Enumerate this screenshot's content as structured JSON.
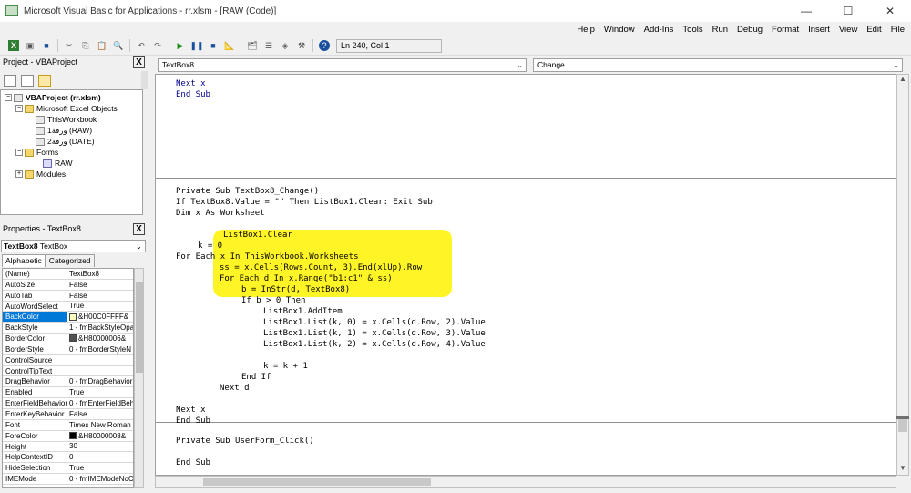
{
  "window": {
    "title": "Microsoft Visual Basic for Applications - rr.xlsm - [RAW (Code)]",
    "controls": [
      "—",
      "☐",
      "✕"
    ]
  },
  "menu": [
    "File",
    "Edit",
    "View",
    "Insert",
    "Format",
    "Debug",
    "Run",
    "Tools",
    "Add-Ins",
    "Window",
    "Help"
  ],
  "toolbar": {
    "position": "Ln 240, Col 1"
  },
  "project": {
    "header": "Project - VBAProject",
    "close": "X",
    "root": "VBAProject (rr.xlsm)",
    "excel_objects_folder": "Microsoft Excel Objects",
    "this_workbook": "ThisWorkbook",
    "sheet1": "ورقة1 (RAW)",
    "sheet2": "ورقة2 (DATE)",
    "forms_folder": "Forms",
    "form_raw": "RAW",
    "modules_folder": "Modules"
  },
  "properties": {
    "header": "Properties - TextBox8",
    "close": "X",
    "object_name": "TextBox8",
    "object_type": "TextBox",
    "tab_alphabetic": "Alphabetic",
    "tab_categorized": "Categorized",
    "rows": [
      {
        "name": "(Name)",
        "value": "TextBox8"
      },
      {
        "name": "AutoSize",
        "value": "False"
      },
      {
        "name": "AutoTab",
        "value": "False"
      },
      {
        "name": "AutoWordSelect",
        "value": "True"
      },
      {
        "name": "BackColor",
        "value": "&H00C0FFFF&"
      },
      {
        "name": "BackStyle",
        "value": "1 - fmBackStyleOpa"
      },
      {
        "name": "BorderColor",
        "value": "&H80000006&"
      },
      {
        "name": "BorderStyle",
        "value": "0 - fmBorderStyleN"
      },
      {
        "name": "ControlSource",
        "value": ""
      },
      {
        "name": "ControlTipText",
        "value": ""
      },
      {
        "name": "DragBehavior",
        "value": "0 - fmDragBehavior"
      },
      {
        "name": "Enabled",
        "value": "True"
      },
      {
        "name": "EnterFieldBehavior",
        "value": "0 - fmEnterFieldBeh"
      },
      {
        "name": "EnterKeyBehavior",
        "value": "False"
      },
      {
        "name": "Font",
        "value": "Times New Roman"
      },
      {
        "name": "ForeColor",
        "value": "&H80000008&"
      },
      {
        "name": "Height",
        "value": "30"
      },
      {
        "name": "HelpContextID",
        "value": "0"
      },
      {
        "name": "HideSelection",
        "value": "True"
      },
      {
        "name": "IMEMode",
        "value": "0 - fmIMEModeNoC"
      }
    ]
  },
  "code": {
    "object_combo": "TextBox8",
    "procedure_combo": "Change",
    "lines": [
      "Next x",
      "End Sub",
      "Private Sub TextBox8_Change()",
      "If TextBox8.Value = \"\" Then ListBox1.Clear: Exit Sub",
      "Dim x As Worksheet",
      "ListBox1.Clear",
      "k = 0",
      "For Each x In ThisWorkbook.Worksheets",
      "ss = x.Cells(Rows.Count, 3).End(xlUp).Row",
      "For Each d In x.Range(\"b1:c1\" & ss)",
      "b = InStr(d, TextBox8)",
      "If b > 0 Then",
      "ListBox1.AddItem",
      "ListBox1.List(k, 0) = x.Cells(d.Row, 2).Value",
      "ListBox1.List(k, 1) = x.Cells(d.Row, 3).Value",
      "ListBox1.List(k, 2) = x.Cells(d.Row, 4).Value",
      "k = k + 1",
      "End If",
      "Next d",
      "Next x",
      "End Sub",
      "Private Sub UserForm_Click()",
      "End Sub"
    ]
  },
  "colors": {
    "highlight": "#fff200",
    "selection": "#0078d7",
    "keyword": "#00008b"
  }
}
